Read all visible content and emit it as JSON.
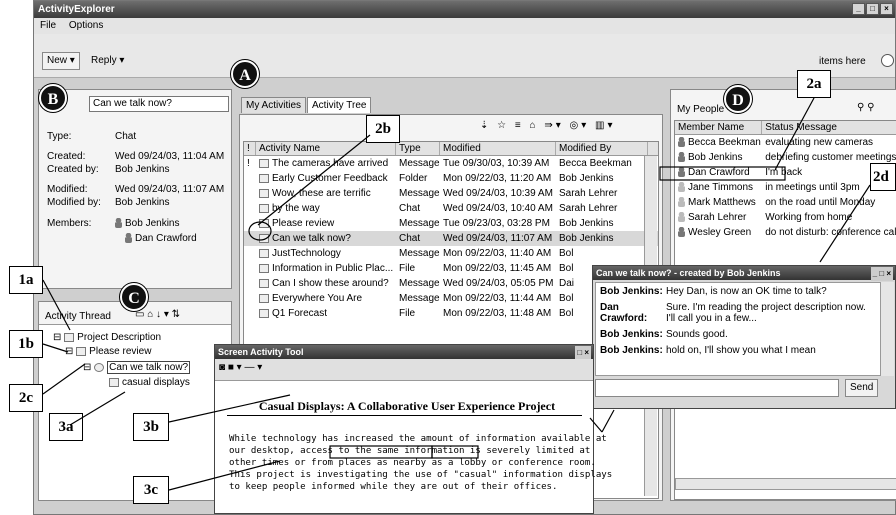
{
  "app": {
    "title": "ActivityExplorer",
    "menu": [
      "File",
      "Options"
    ]
  },
  "toolbar": {
    "new_label": "New",
    "reply_label": "Reply",
    "drop_hint": "items here"
  },
  "details": {
    "subject": "Can we talk now?",
    "type_label": "Type:",
    "type_value": "Chat",
    "created_label": "Created:",
    "created_value": "Wed 09/24/03, 11:04 AM",
    "created_by_label": "Created by:",
    "created_by_value": "Bob Jenkins",
    "modified_label": "Modified:",
    "modified_value": "Wed 09/24/03, 11:07 AM",
    "modified_by_label": "Modified by:",
    "modified_by_value": "Bob Jenkins",
    "members_label": "Members:",
    "members": [
      "Bob Jenkins",
      "Dan Crawford"
    ]
  },
  "thread": {
    "title": "Activity Thread",
    "items": [
      "Project Description",
      "Please review",
      "Can we talk now?",
      "casual displays"
    ]
  },
  "activities": {
    "tabs": [
      "My Activities",
      "Activity Tree"
    ],
    "columns": [
      "!",
      "Activity Name",
      "Type",
      "Modified",
      "Modified By"
    ],
    "rows": [
      {
        "flag": "!",
        "name": "The cameras have arrived",
        "type": "Message",
        "modified": "Tue 09/30/03, 10:39 AM",
        "by": "Becca Beekman"
      },
      {
        "flag": "",
        "name": "Early Customer Feedback",
        "type": "Folder",
        "modified": "Mon 09/22/03, 11:20 AM",
        "by": "Bob Jenkins"
      },
      {
        "flag": "",
        "name": "Wow, these are terrific",
        "type": "Message",
        "modified": "Wed 09/24/03, 10:39 AM",
        "by": "Sarah Lehrer"
      },
      {
        "flag": "",
        "name": "by the way",
        "type": "Chat",
        "modified": "Wed 09/24/03, 10:40 AM",
        "by": "Sarah Lehrer"
      },
      {
        "flag": "",
        "name": "Please review",
        "type": "Message",
        "modified": "Tue 09/23/03, 03:28 PM",
        "by": "Bob Jenkins"
      },
      {
        "flag": "",
        "name": "Can we talk now?",
        "type": "Chat",
        "modified": "Wed 09/24/03, 11:07 AM",
        "by": "Bob Jenkins"
      },
      {
        "flag": "",
        "name": "JustTechnology",
        "type": "Message",
        "modified": "Mon 09/22/03, 11:40 AM",
        "by": "Bol"
      },
      {
        "flag": "",
        "name": "Information in Public Plac...",
        "type": "File",
        "modified": "Mon 09/22/03, 11:45 AM",
        "by": "Bol"
      },
      {
        "flag": "",
        "name": "Can I show these around?",
        "type": "Message",
        "modified": "Wed 09/24/03, 05:05 PM",
        "by": "Dai"
      },
      {
        "flag": "",
        "name": "Everywhere You Are",
        "type": "Message",
        "modified": "Mon 09/22/03, 11:44 AM",
        "by": "Bol"
      },
      {
        "flag": "",
        "name": "Q1 Forecast",
        "type": "File",
        "modified": "Mon 09/22/03, 11:48 AM",
        "by": "Bol"
      }
    ]
  },
  "people": {
    "title": "My People",
    "columns": [
      "Member Name",
      "Status Message"
    ],
    "rows": [
      {
        "name": "Becca Beekman",
        "status": "evaluating new cameras",
        "online": true
      },
      {
        "name": "Bob Jenkins",
        "status": "debriefing customer meetings",
        "online": true
      },
      {
        "name": "Dan Crawford",
        "status": "I'm back",
        "online": true
      },
      {
        "name": "Jane Timmons",
        "status": "in meetings until 3pm",
        "online": false
      },
      {
        "name": "Mark Matthews",
        "status": "on the road until Monday",
        "online": false
      },
      {
        "name": "Sarah Lehrer",
        "status": "Working from home",
        "online": false
      },
      {
        "name": "Wesley Green",
        "status": "do not disturb: conference call",
        "online": true
      }
    ]
  },
  "chat": {
    "title": "Can we talk now? - created by Bob Jenkins",
    "messages": [
      {
        "who": "Bob Jenkins:",
        "text": "Hey Dan, is now an OK time to talk?"
      },
      {
        "who": "Dan Crawford:",
        "text": "Sure. I'm reading the project description now. I'll call you in a few..."
      },
      {
        "who": "Bob Jenkins:",
        "text": "Sounds good."
      },
      {
        "who": "Bob Jenkins:",
        "text": "hold on, I'll show you what I mean"
      }
    ],
    "send_label": "Send"
  },
  "screen_tool": {
    "title": "Screen Activity Tool",
    "doc_title": "Casual Displays: A Collaborative User Experience Project",
    "body": "While technology has increased the amount of information available at our desktop, access to the same information is severely limited at other times or from places as nearby as a lobby or conference room. This project is investigating the use of \"casual\" information displays to keep people informed while they are out of their offices."
  },
  "callouts": {
    "A": "A",
    "B": "B",
    "C": "C",
    "D": "D",
    "c1a": "1a",
    "c1b": "1b",
    "c2a": "2a",
    "c2b": "2b",
    "c2c": "2c",
    "c2d": "2d",
    "c3a": "3a",
    "c3b": "3b",
    "c3c": "3c"
  }
}
